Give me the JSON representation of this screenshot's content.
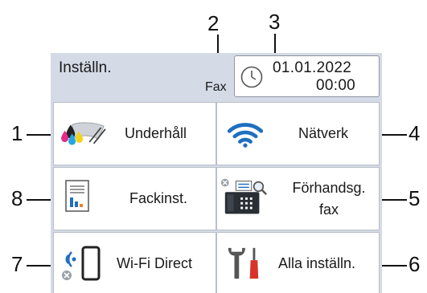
{
  "status": {
    "title": "Inställn.",
    "fax_indicator": "Fax",
    "date": "01.01.2022",
    "time": "00:00"
  },
  "tiles": {
    "maintenance": "Underhåll",
    "network": "Nätverk",
    "fax_settings": "Fackinst.",
    "fax_preview_line1": "Förhandsg.",
    "fax_preview_line2": "fax",
    "wifi_direct": "Wi-Fi Direct",
    "all_settings": "Alla inställn."
  },
  "callouts": [
    "1",
    "2",
    "3",
    "4",
    "5",
    "6",
    "7",
    "8"
  ],
  "colors": {
    "header_bg": "#d4dbe6",
    "wifi_blue": "#1f6fc0",
    "tool_red": "#d8322a"
  }
}
